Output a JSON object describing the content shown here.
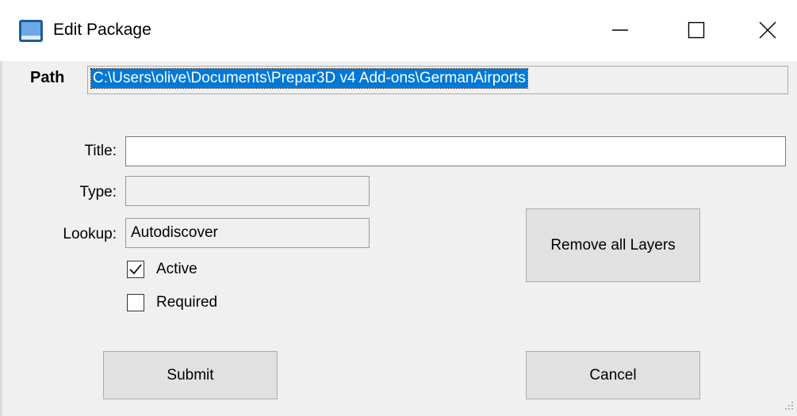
{
  "window": {
    "title": "Edit Package",
    "icon": "app-icon"
  },
  "titlebar": {
    "minimize": "minimize-icon",
    "maximize": "maximize-icon",
    "close": "close-icon"
  },
  "path": {
    "label": "Path",
    "value": "C:\\Users\\olive\\Documents\\Prepar3D v4 Add-ons\\GermanAirports"
  },
  "form": {
    "title_label": "Title:",
    "title_value": "",
    "type_label": "Type:",
    "type_value": "",
    "lookup_label": "Lookup:",
    "lookup_value": "Autodiscover",
    "active_label": "Active",
    "active_checked": true,
    "required_label": "Required",
    "required_checked": false
  },
  "buttons": {
    "remove_layers": "Remove all Layers",
    "submit": "Submit",
    "cancel": "Cancel"
  },
  "colors": {
    "selection": "#0078d7",
    "window_bg": "#f0f0f0",
    "titlebar_bg": "#ffffff"
  }
}
